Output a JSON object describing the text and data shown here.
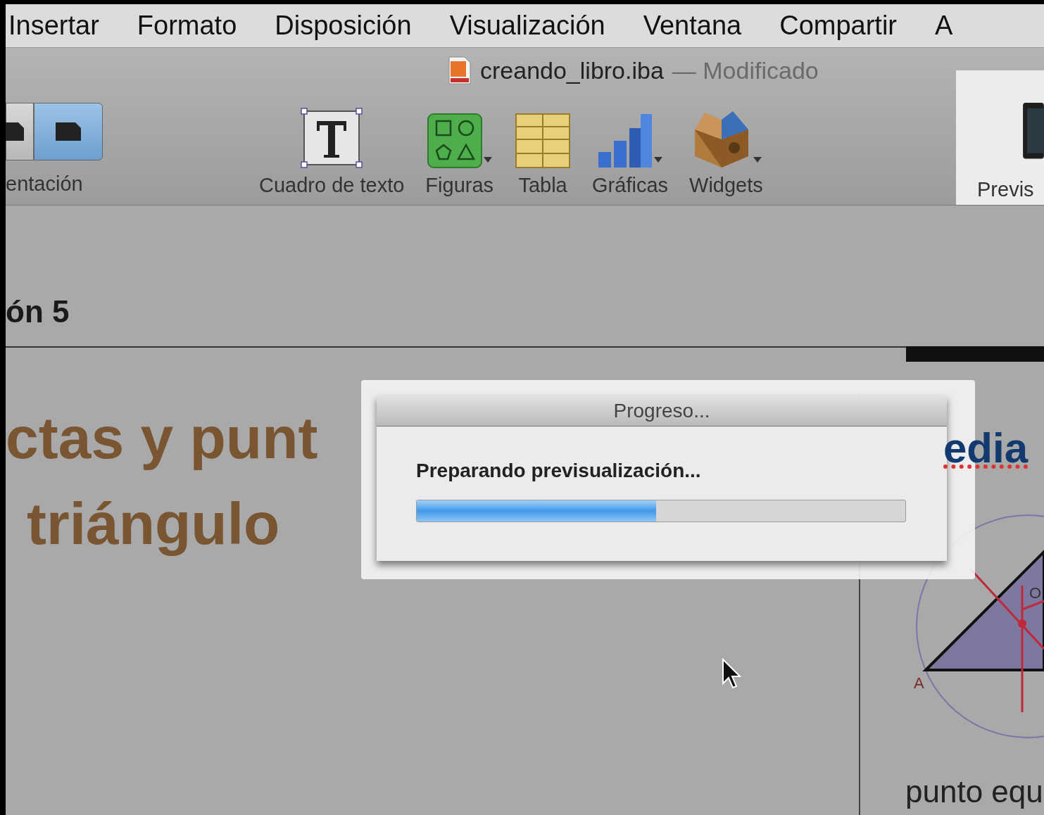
{
  "menu_bar": {
    "items": [
      "Insertar",
      "Formato",
      "Disposición",
      "Visualización",
      "Ventana",
      "Compartir",
      "A"
    ]
  },
  "toolbar": {
    "document": {
      "name": "creando_libro.iba",
      "status": "— Modificado"
    },
    "view_switch": {
      "label": "entación",
      "segments": [
        {
          "selected": false
        },
        {
          "selected": true
        }
      ]
    },
    "tools": [
      {
        "kind": "textbox",
        "label": "Cuadro de texto",
        "menu": false
      },
      {
        "kind": "shapes",
        "label": "Figuras",
        "menu": true
      },
      {
        "kind": "table",
        "label": "Tabla",
        "menu": false
      },
      {
        "kind": "charts",
        "label": "Gráficas",
        "menu": true
      },
      {
        "kind": "widgets",
        "label": "Widgets",
        "menu": true
      }
    ],
    "preview": {
      "label": "Previs"
    }
  },
  "page": {
    "section_heading": "ón 5",
    "title_lines": [
      "ctas y punt",
      "triángulo"
    ],
    "side_heading": "edia",
    "diagram_labels": [
      "A",
      "O"
    ],
    "caption": "punto equ"
  },
  "dialog": {
    "title": "Progreso...",
    "message": "Preparando previsualización...",
    "level": 0.49
  }
}
